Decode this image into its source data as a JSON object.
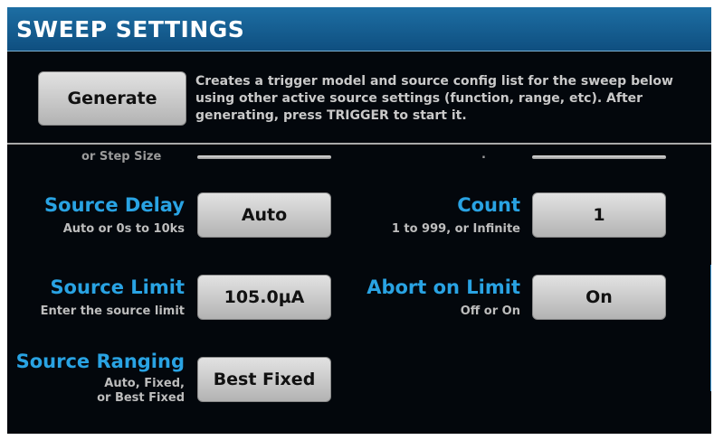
{
  "header": {
    "title": "SWEEP SETTINGS"
  },
  "generate": {
    "button_label": "Generate",
    "description": "Creates a trigger model and source config list for the sweep below using other active source settings (function, range, etc). After generating, press TRIGGER to start it."
  },
  "partial_row": {
    "left_hint": "or Step Size",
    "right_hint": "."
  },
  "settings": {
    "source_delay": {
      "label": "Source Delay",
      "hint": "Auto or 0s to 10ks",
      "value": "Auto"
    },
    "count": {
      "label": "Count",
      "hint": "1 to 999, or Infinite",
      "value": "1"
    },
    "source_limit": {
      "label": "Source Limit",
      "hint": "Enter the source limit",
      "value": "105.0µA"
    },
    "abort_on_limit": {
      "label": "Abort on Limit",
      "hint": "Off or On",
      "value": "On"
    },
    "source_ranging": {
      "label": "Source Ranging",
      "hint_lines": [
        "Auto, Fixed,",
        "or Best Fixed"
      ],
      "value": "Best Fixed"
    }
  }
}
